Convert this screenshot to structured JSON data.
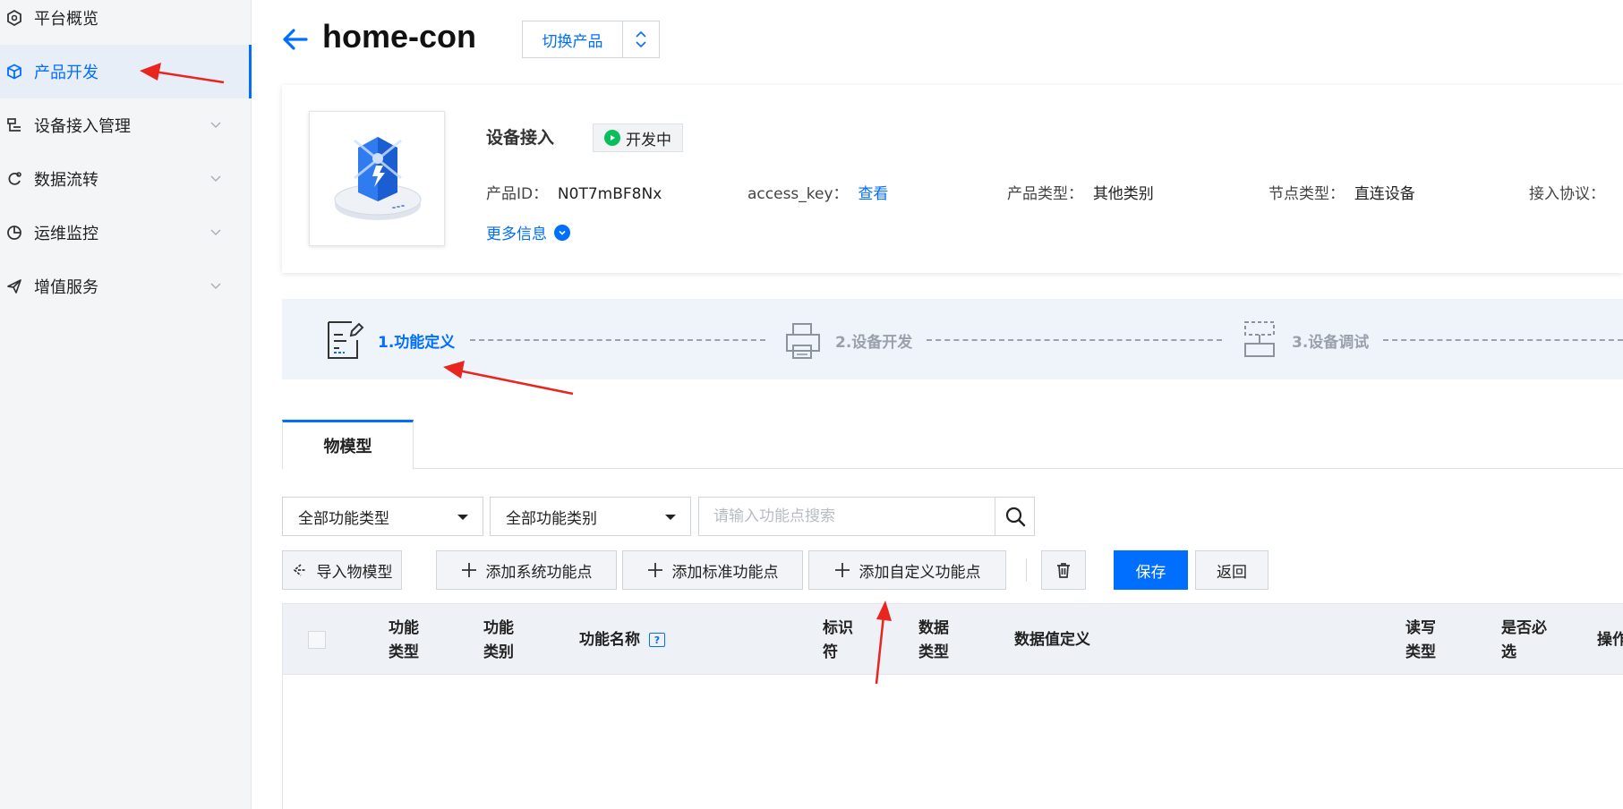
{
  "sidebar": {
    "items": [
      {
        "label": "平台概览",
        "icon": "overview-icon",
        "has_chevron": false,
        "active": false
      },
      {
        "label": "产品开发",
        "icon": "cube-icon",
        "has_chevron": false,
        "active": true
      },
      {
        "label": "设备接入管理",
        "icon": "device-access-icon",
        "has_chevron": true,
        "active": false
      },
      {
        "label": "数据流转",
        "icon": "data-flow-icon",
        "has_chevron": true,
        "active": false
      },
      {
        "label": "运维监控",
        "icon": "monitor-pie-icon",
        "has_chevron": true,
        "active": false
      },
      {
        "label": "增值服务",
        "icon": "send-icon",
        "has_chevron": true,
        "active": false
      }
    ]
  },
  "header": {
    "title": "home-con",
    "switch_label": "切换产品"
  },
  "product": {
    "name": "设备接入",
    "status": "开发中",
    "fields": [
      {
        "label": "产品ID：",
        "value": "N0T7mBF8Nx"
      },
      {
        "label": "access_key：",
        "value": "查看",
        "is_link": true
      },
      {
        "label": "产品类型：",
        "value": "其他类别"
      },
      {
        "label": "节点类型：",
        "value": "直连设备"
      },
      {
        "label": "接入协议：",
        "value": ""
      }
    ],
    "more_info": "更多信息"
  },
  "steps": [
    {
      "label": "1.功能定义",
      "active": true
    },
    {
      "label": "2.设备开发",
      "active": false
    },
    {
      "label": "3.设备调试",
      "active": false
    }
  ],
  "tabs": [
    {
      "label": "物模型",
      "active": true
    }
  ],
  "filters": {
    "type_select": "全部功能类型",
    "category_select": "全部功能类别",
    "search_placeholder": "请输入功能点搜索"
  },
  "toolbar": {
    "import_label": "导入物模型",
    "add_system_label": "添加系统功能点",
    "add_standard_label": "添加标准功能点",
    "add_custom_label": "添加自定义功能点",
    "save_label": "保存",
    "back_label": "返回"
  },
  "table": {
    "columns": [
      {
        "line1": "功能",
        "line2": "类型"
      },
      {
        "line1": "功能",
        "line2": "类别"
      },
      {
        "line1": "功能名称",
        "line2": ""
      },
      {
        "line1": "标识",
        "line2": "符"
      },
      {
        "line1": "数据",
        "line2": "类型"
      },
      {
        "line1": "数据值定义",
        "line2": ""
      },
      {
        "line1": "读写",
        "line2": "类型"
      },
      {
        "line1": "是否必",
        "line2": "选"
      },
      {
        "line1": "操作",
        "line2": ""
      }
    ],
    "rows": []
  },
  "colors": {
    "primary": "#006eff",
    "status_green": "#0abf5b",
    "annotation_red": "#e8261f"
  }
}
